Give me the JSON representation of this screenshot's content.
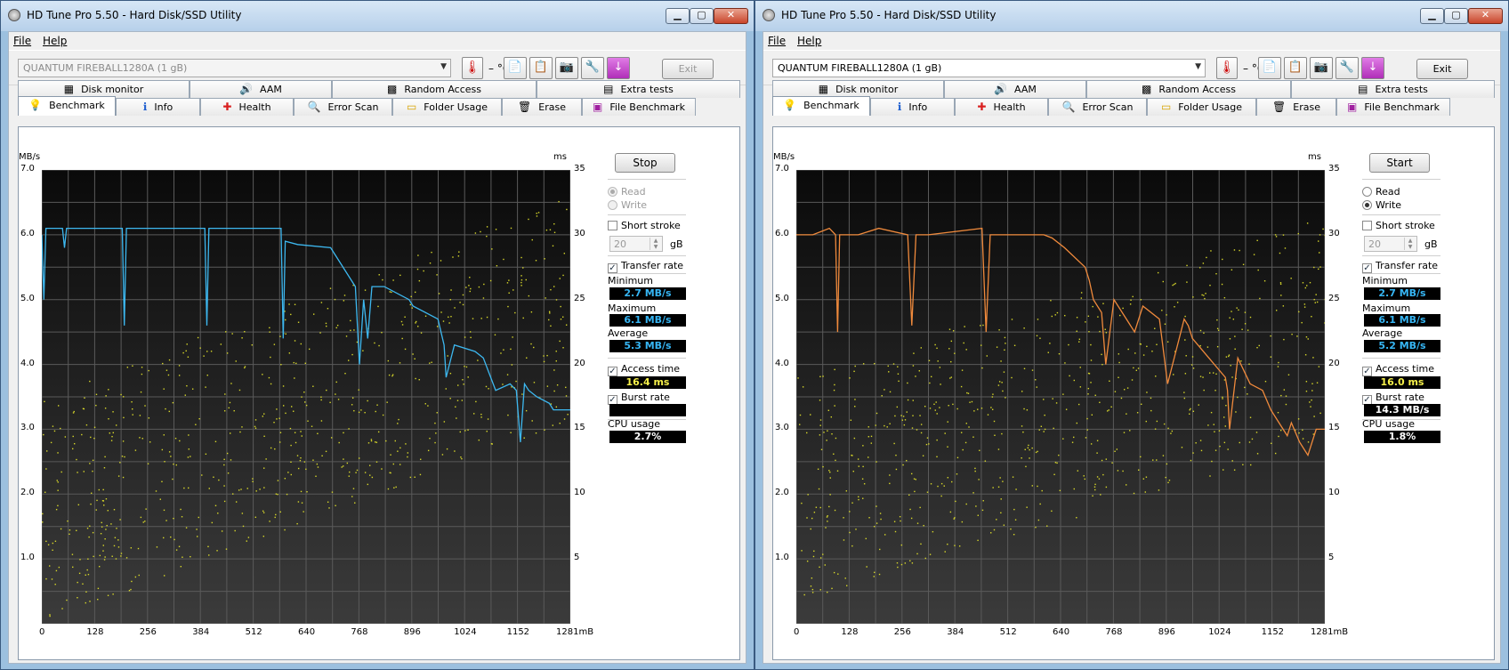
{
  "windows": [
    {
      "title": "HD Tune Pro 5.50 - Hard Disk/SSD Utility",
      "menu": [
        "File",
        "Help"
      ],
      "drive": "QUANTUM FIREBALL1280A (1 gB)",
      "drive_enabled": false,
      "temperature": "– °C",
      "exit_label": "Exit",
      "exit_enabled": false,
      "tabs_top": [
        "Disk monitor",
        "AAM",
        "Random Access",
        "Extra tests"
      ],
      "tabs_bottom": [
        "Benchmark",
        "Info",
        "Health",
        "Error Scan",
        "Folder Usage",
        "Erase",
        "File Benchmark"
      ],
      "active_tab": "Benchmark",
      "action_button": "Stop",
      "mode": "read",
      "mode_enabled": false,
      "read_label": "Read",
      "write_label": "Write",
      "short_stroke_label": "Short stroke",
      "short_stroke_checked": false,
      "stroke_value": "20",
      "stroke_unit": "gB",
      "transfer_rate_label": "Transfer rate",
      "minimum_label": "Minimum",
      "minimum": "2.7 MB/s",
      "maximum_label": "Maximum",
      "maximum": "6.1 MB/s",
      "average_label": "Average",
      "average": "5.3 MB/s",
      "access_time_label": "Access time",
      "access_time": "16.4 ms",
      "burst_rate_label": "Burst rate",
      "burst_rate": "",
      "cpu_usage_label": "CPU usage",
      "cpu_usage": "2.7%",
      "line_color": "#3db8f0"
    },
    {
      "title": "HD Tune Pro 5.50 - Hard Disk/SSD Utility",
      "menu": [
        "File",
        "Help"
      ],
      "drive": "QUANTUM FIREBALL1280A (1 gB)",
      "drive_enabled": true,
      "temperature": "– °C",
      "exit_label": "Exit",
      "exit_enabled": true,
      "tabs_top": [
        "Disk monitor",
        "AAM",
        "Random Access",
        "Extra tests"
      ],
      "tabs_bottom": [
        "Benchmark",
        "Info",
        "Health",
        "Error Scan",
        "Folder Usage",
        "Erase",
        "File Benchmark"
      ],
      "active_tab": "Benchmark",
      "action_button": "Start",
      "mode": "write",
      "mode_enabled": true,
      "read_label": "Read",
      "write_label": "Write",
      "short_stroke_label": "Short stroke",
      "short_stroke_checked": false,
      "stroke_value": "20",
      "stroke_unit": "gB",
      "transfer_rate_label": "Transfer rate",
      "minimum_label": "Minimum",
      "minimum": "2.7 MB/s",
      "maximum_label": "Maximum",
      "maximum": "6.1 MB/s",
      "average_label": "Average",
      "average": "5.2 MB/s",
      "access_time_label": "Access time",
      "access_time": "16.0 ms",
      "burst_rate_label": "Burst rate",
      "burst_rate": "14.3 MB/s",
      "cpu_usage_label": "CPU usage",
      "cpu_usage": "1.8%",
      "line_color": "#f08a3c"
    }
  ],
  "chart_data": [
    {
      "type": "line",
      "xlabel": "mB",
      "ylabel": "MB/s",
      "y2label": "ms",
      "x_ticks": [
        "0",
        "128",
        "256",
        "384",
        "512",
        "640",
        "768",
        "896",
        "1024",
        "1152",
        "1281mB"
      ],
      "y_ticks": [
        "1.0",
        "2.0",
        "3.0",
        "4.0",
        "5.0",
        "6.0",
        "7.0"
      ],
      "y2_ticks": [
        "5",
        "10",
        "15",
        "20",
        "25",
        "30",
        "35"
      ],
      "xlim": [
        0,
        1281
      ],
      "ylim": [
        0,
        7
      ],
      "y2lim": [
        0,
        35
      ],
      "series": [
        {
          "x": [
            0,
            5,
            10,
            50,
            55,
            60,
            100,
            195,
            200,
            205,
            240,
            395,
            400,
            405,
            430,
            580,
            585,
            590,
            620,
            700,
            720,
            760,
            770,
            780,
            790,
            800,
            830,
            890,
            900,
            960,
            975,
            980,
            1000,
            1050,
            1070,
            1100,
            1135,
            1150,
            1160,
            1170,
            1180,
            1200,
            1230,
            1240,
            1281
          ],
          "y": [
            6.0,
            5.0,
            6.1,
            6.1,
            5.8,
            6.1,
            6.1,
            6.1,
            4.6,
            6.1,
            6.1,
            6.1,
            4.6,
            6.1,
            6.1,
            6.1,
            4.4,
            5.9,
            5.85,
            5.8,
            5.6,
            5.2,
            4.0,
            5.0,
            4.4,
            5.2,
            5.2,
            5.0,
            4.9,
            4.7,
            4.3,
            3.8,
            4.3,
            4.2,
            4.1,
            3.6,
            3.7,
            3.6,
            2.8,
            3.7,
            3.6,
            3.5,
            3.4,
            3.3,
            3.3
          ]
        }
      ],
      "scatter_note": "access time"
    },
    {
      "type": "line",
      "xlabel": "mB",
      "ylabel": "MB/s",
      "y2label": "ms",
      "x_ticks": [
        "0",
        "128",
        "256",
        "384",
        "512",
        "640",
        "768",
        "896",
        "1024",
        "1152",
        "1281mB"
      ],
      "y_ticks": [
        "1.0",
        "2.0",
        "3.0",
        "4.0",
        "5.0",
        "6.0",
        "7.0"
      ],
      "y2_ticks": [
        "5",
        "10",
        "15",
        "20",
        "25",
        "30",
        "35"
      ],
      "xlim": [
        0,
        1281
      ],
      "ylim": [
        0,
        7
      ],
      "y2lim": [
        0,
        35
      ],
      "series": [
        {
          "x": [
            0,
            40,
            80,
            95,
            100,
            105,
            150,
            200,
            270,
            280,
            290,
            320,
            450,
            460,
            470,
            520,
            600,
            620,
            650,
            700,
            710,
            720,
            740,
            750,
            770,
            800,
            820,
            840,
            880,
            900,
            940,
            950,
            960,
            1000,
            1040,
            1045,
            1050,
            1070,
            1100,
            1130,
            1150,
            1170,
            1190,
            1200,
            1220,
            1240,
            1260,
            1281
          ],
          "y": [
            6.0,
            6.0,
            6.1,
            6.0,
            4.5,
            6.0,
            6.0,
            6.1,
            6.0,
            4.6,
            6.0,
            6.0,
            6.1,
            4.5,
            6.0,
            6.0,
            6.0,
            5.95,
            5.8,
            5.5,
            5.3,
            5.0,
            4.8,
            4.0,
            5.0,
            4.7,
            4.5,
            4.9,
            4.7,
            3.7,
            4.7,
            4.6,
            4.4,
            4.1,
            3.8,
            3.6,
            3.0,
            4.1,
            3.7,
            3.6,
            3.3,
            3.1,
            2.9,
            3.1,
            2.8,
            2.6,
            3.0,
            3.0
          ]
        }
      ],
      "scatter_note": "access time"
    }
  ]
}
